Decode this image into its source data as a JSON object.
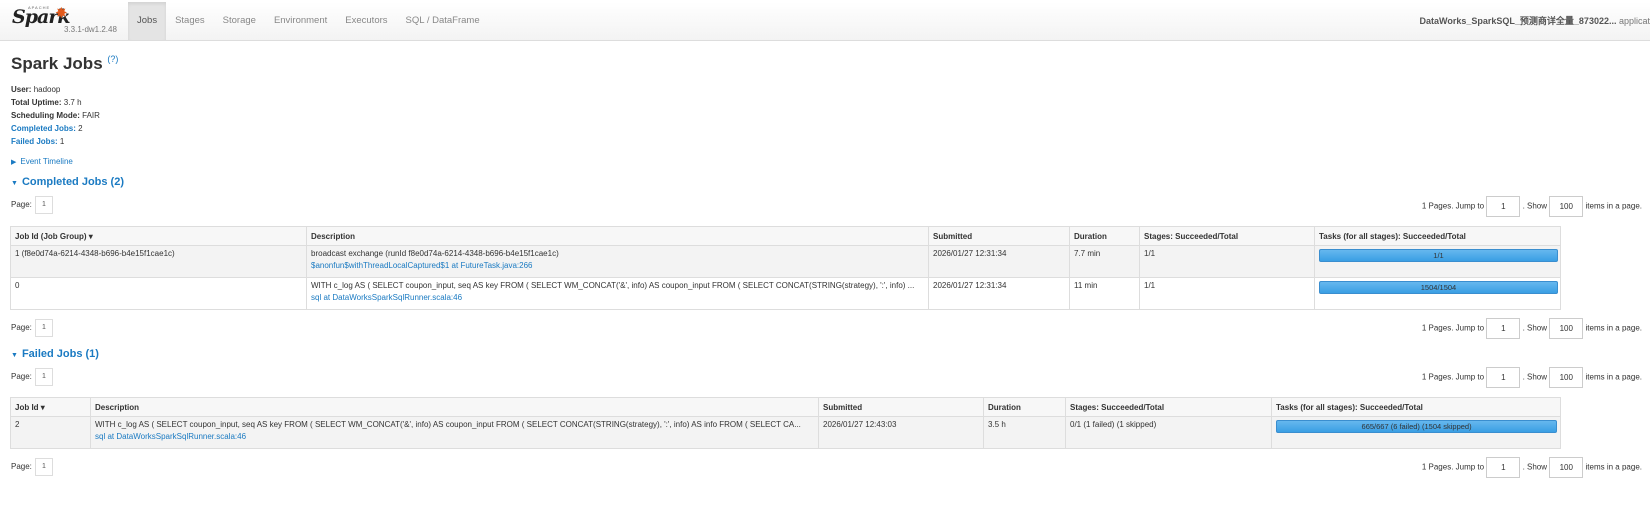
{
  "brand": {
    "logo": "Spark",
    "apache": "APACHE",
    "version": "3.3.1-dw1.2.48"
  },
  "nav": {
    "tabs": [
      "Jobs",
      "Stages",
      "Storage",
      "Environment",
      "Executors",
      "SQL / DataFrame"
    ]
  },
  "app_title": {
    "name": "DataWorks_SparkSQL_预测商详全量_873022...",
    "suffix": " applicat"
  },
  "page": {
    "title": "Spark Jobs",
    "help": "(?)"
  },
  "summary": {
    "user_label": "User:",
    "user": "hadoop",
    "uptime_label": "Total Uptime:",
    "uptime": "3.7 h",
    "mode_label": "Scheduling Mode:",
    "mode": "FAIR",
    "completed_label": "Completed Jobs:",
    "completed": "2",
    "failed_label": "Failed Jobs:",
    "failed": "1"
  },
  "event_timeline": "Event Timeline",
  "completed_section": "Completed Jobs (2)",
  "failed_section": "Failed Jobs (1)",
  "pager": {
    "page_label": "Page:",
    "page": "1",
    "pages_text": "1 Pages. Jump to",
    "jump_value": "1",
    "show_text": ". Show",
    "show_value": "100",
    "items_text": "items in a page."
  },
  "completed_table": {
    "headers": [
      "Job Id (Job Group) ▾",
      "Description",
      "Submitted",
      "Duration",
      "Stages: Succeeded/Total",
      "Tasks (for all stages): Succeeded/Total"
    ],
    "rows": [
      {
        "id": "1 (f8e0d74a-6214-4348-b696-b4e15f1cae1c)",
        "desc": "broadcast exchange (runId f8e0d74a-6214-4348-b696-b4e15f1cae1c)",
        "desc_link": "$anonfun$withThreadLocalCaptured$1 at FutureTask.java:266",
        "submitted": "2026/01/27 12:31:34",
        "duration": "7.7 min",
        "stages": "1/1",
        "tasks": "1/1",
        "progress": 1.0
      },
      {
        "id": "0",
        "desc": "WITH c_log AS ( SELECT coupon_input, seq AS key FROM ( SELECT WM_CONCAT('&', info) AS coupon_input FROM ( SELECT CONCAT(STRING(strategy), ':', info) ...",
        "desc_link": "sql at DataWorksSparkSqlRunner.scala:46",
        "submitted": "2026/01/27 12:31:34",
        "duration": "11 min",
        "stages": "1/1",
        "tasks": "1504/1504",
        "progress": 1.0
      }
    ]
  },
  "failed_table": {
    "headers": [
      "Job Id ▾",
      "Description",
      "Submitted",
      "Duration",
      "Stages: Succeeded/Total",
      "Tasks (for all stages): Succeeded/Total"
    ],
    "rows": [
      {
        "id": "2",
        "desc": "WITH c_log AS ( SELECT coupon_input, seq AS key FROM ( SELECT WM_CONCAT('&', info) AS coupon_input FROM ( SELECT CONCAT(STRING(strategy), ':', info) AS info FROM ( SELECT CA...",
        "desc_link": "sql at DataWorksSparkSqlRunner.scala:46",
        "submitted": "2026/01/27 12:43:03",
        "duration": "3.5 h",
        "stages": "0/1 (1 failed) (1 skipped)",
        "tasks": "665/667 (6 failed) (1504 skipped)",
        "progress": 0.997
      }
    ]
  }
}
